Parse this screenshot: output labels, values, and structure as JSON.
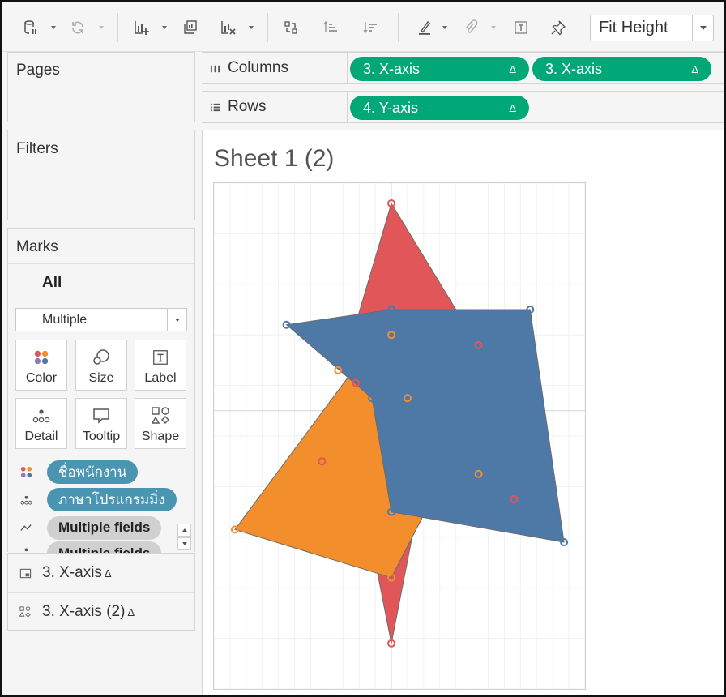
{
  "toolbar": {
    "icons": [
      "datasource-icon",
      "refresh-icon",
      "new-worksheet-icon",
      "duplicate-sheet-icon",
      "clear-sheet-icon",
      "swap-axes-icon",
      "sort-ascending-icon",
      "sort-descending-icon",
      "highlight-icon",
      "group-icon",
      "show-labels-icon",
      "pin-icon"
    ],
    "fit_label": "Fit Height"
  },
  "panels": {
    "pages_title": "Pages",
    "filters_title": "Filters",
    "marks_title": "Marks"
  },
  "marks": {
    "all_label": "All",
    "mark_type": "Multiple",
    "buttons": [
      {
        "label": "Color"
      },
      {
        "label": "Size"
      },
      {
        "label": "Label"
      },
      {
        "label": "Detail"
      },
      {
        "label": "Tooltip"
      },
      {
        "label": "Shape"
      }
    ],
    "shelf_items": [
      {
        "label": "ชื่อพนักงาน"
      },
      {
        "label": "ภาษาโปรแกรมมิ่ง"
      },
      {
        "label": "Multiple fields"
      },
      {
        "label": "Multiple fields"
      }
    ]
  },
  "legends": [
    {
      "label": "3. X-axis",
      "suffix": "Δ"
    },
    {
      "label": "3. X-axis (2)",
      "suffix": "Δ"
    }
  ],
  "shelves": {
    "columns_label": "Columns",
    "rows_label": "Rows",
    "columns_pills": [
      {
        "label": "3. X-axis",
        "suffix": "Δ"
      },
      {
        "label": "3. X-axis",
        "suffix": "Δ"
      }
    ],
    "rows_pills": [
      {
        "label": "4. Y-axis",
        "suffix": "Δ"
      }
    ]
  },
  "sheet": {
    "title": "Sheet 1 (2)"
  },
  "colors": {
    "red": "#e15759",
    "orange": "#f28e2b",
    "blue": "#4e79a7",
    "pill_green": "#00a878",
    "pill_teal": "#4a96b2"
  },
  "chart_data": {
    "type": "polygon",
    "xlim": [
      -11,
      12
    ],
    "ylim": [
      -11,
      9
    ],
    "grid": true,
    "zero_lines": true,
    "polygons": [
      {
        "color": "#e15759",
        "vertices": [
          [
            0,
            8.2
          ],
          [
            4,
            4.0
          ],
          [
            2.2,
            -2.0
          ],
          [
            0,
            -9.2
          ],
          [
            -2,
            -2.7
          ],
          [
            -2.6,
            2.6
          ]
        ]
      },
      {
        "color": "#f28e2b",
        "vertices": [
          [
            -1.2,
            2.6
          ],
          [
            0,
            0.5
          ],
          [
            2.5,
            -3.5
          ],
          [
            0,
            -6.6
          ],
          [
            -9.7,
            -4.7
          ]
        ]
      },
      {
        "color": "#4e79a7",
        "vertices": [
          [
            -6.5,
            3.4
          ],
          [
            0,
            4.0
          ],
          [
            8.6,
            4.0
          ],
          [
            10.7,
            -5.2
          ],
          [
            0,
            -4.0
          ],
          [
            -1.2,
            0.5
          ]
        ]
      }
    ],
    "points": [
      {
        "color": "#e15759",
        "x": 0,
        "y": 8.2
      },
      {
        "color": "#e15759",
        "x": 5.4,
        "y": 2.6
      },
      {
        "color": "#e15759",
        "x": -2.2,
        "y": 1.1
      },
      {
        "color": "#e15759",
        "x": -4.3,
        "y": -2.0
      },
      {
        "color": "#e15759",
        "x": 7.6,
        "y": -3.5
      },
      {
        "color": "#e15759",
        "x": 0,
        "y": -9.2
      },
      {
        "color": "#f28e2b",
        "x": 0,
        "y": 3.0
      },
      {
        "color": "#f28e2b",
        "x": -3.3,
        "y": 1.6
      },
      {
        "color": "#f28e2b",
        "x": 1.0,
        "y": 0.5
      },
      {
        "color": "#f28e2b",
        "x": 5.4,
        "y": -2.5
      },
      {
        "color": "#f28e2b",
        "x": -9.7,
        "y": -4.7
      },
      {
        "color": "#f28e2b",
        "x": 0,
        "y": -6.6
      },
      {
        "color": "#4e79a7",
        "x": -6.5,
        "y": 3.4
      },
      {
        "color": "#4e79a7",
        "x": 0,
        "y": 4.0
      },
      {
        "color": "#4e79a7",
        "x": 8.6,
        "y": 4.0
      },
      {
        "color": "#4e79a7",
        "x": 10.7,
        "y": -5.2
      },
      {
        "color": "#4e79a7",
        "x": 0,
        "y": -4.0
      },
      {
        "color": "#4e79a7",
        "x": -1.2,
        "y": 0.5
      }
    ]
  }
}
